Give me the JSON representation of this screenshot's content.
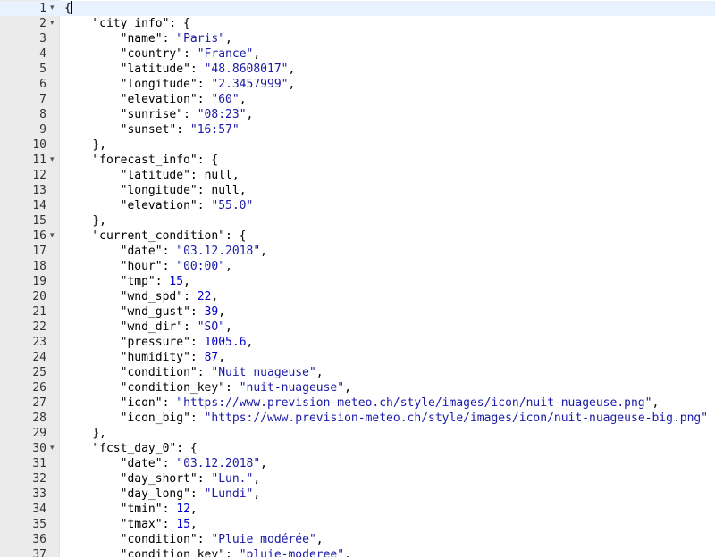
{
  "editor": {
    "lines": [
      {
        "num": "1",
        "fold": true,
        "indent": "",
        "key": "",
        "value": "",
        "vtype": "",
        "suffix": "{"
      },
      {
        "num": "2",
        "fold": true,
        "indent": "    ",
        "key": "\"city_info\"",
        "value": "",
        "vtype": "",
        "suffix": ": {"
      },
      {
        "num": "3",
        "fold": false,
        "indent": "        ",
        "key": "\"name\"",
        "value": "\"Paris\"",
        "vtype": "s",
        "suffix": ","
      },
      {
        "num": "4",
        "fold": false,
        "indent": "        ",
        "key": "\"country\"",
        "value": "\"France\"",
        "vtype": "s",
        "suffix": ","
      },
      {
        "num": "5",
        "fold": false,
        "indent": "        ",
        "key": "\"latitude\"",
        "value": "\"48.8608017\"",
        "vtype": "s",
        "suffix": ","
      },
      {
        "num": "6",
        "fold": false,
        "indent": "        ",
        "key": "\"longitude\"",
        "value": "\"2.3457999\"",
        "vtype": "s",
        "suffix": ","
      },
      {
        "num": "7",
        "fold": false,
        "indent": "        ",
        "key": "\"elevation\"",
        "value": "\"60\"",
        "vtype": "s",
        "suffix": ","
      },
      {
        "num": "8",
        "fold": false,
        "indent": "        ",
        "key": "\"sunrise\"",
        "value": "\"08:23\"",
        "vtype": "s",
        "suffix": ","
      },
      {
        "num": "9",
        "fold": false,
        "indent": "        ",
        "key": "\"sunset\"",
        "value": "\"16:57\"",
        "vtype": "s",
        "suffix": ""
      },
      {
        "num": "10",
        "fold": false,
        "indent": "    ",
        "key": "",
        "value": "",
        "vtype": "",
        "suffix": "},"
      },
      {
        "num": "11",
        "fold": true,
        "indent": "    ",
        "key": "\"forecast_info\"",
        "value": "",
        "vtype": "",
        "suffix": ": {"
      },
      {
        "num": "12",
        "fold": false,
        "indent": "        ",
        "key": "\"latitude\"",
        "value": "null",
        "vtype": "p",
        "suffix": ","
      },
      {
        "num": "13",
        "fold": false,
        "indent": "        ",
        "key": "\"longitude\"",
        "value": "null",
        "vtype": "p",
        "suffix": ","
      },
      {
        "num": "14",
        "fold": false,
        "indent": "        ",
        "key": "\"elevation\"",
        "value": "\"55.0\"",
        "vtype": "s",
        "suffix": ""
      },
      {
        "num": "15",
        "fold": false,
        "indent": "    ",
        "key": "",
        "value": "",
        "vtype": "",
        "suffix": "},"
      },
      {
        "num": "16",
        "fold": true,
        "indent": "    ",
        "key": "\"current_condition\"",
        "value": "",
        "vtype": "",
        "suffix": ": {"
      },
      {
        "num": "17",
        "fold": false,
        "indent": "        ",
        "key": "\"date\"",
        "value": "\"03.12.2018\"",
        "vtype": "s",
        "suffix": ","
      },
      {
        "num": "18",
        "fold": false,
        "indent": "        ",
        "key": "\"hour\"",
        "value": "\"00:00\"",
        "vtype": "s",
        "suffix": ","
      },
      {
        "num": "19",
        "fold": false,
        "indent": "        ",
        "key": "\"tmp\"",
        "value": "15",
        "vtype": "n",
        "suffix": ","
      },
      {
        "num": "20",
        "fold": false,
        "indent": "        ",
        "key": "\"wnd_spd\"",
        "value": "22",
        "vtype": "n",
        "suffix": ","
      },
      {
        "num": "21",
        "fold": false,
        "indent": "        ",
        "key": "\"wnd_gust\"",
        "value": "39",
        "vtype": "n",
        "suffix": ","
      },
      {
        "num": "22",
        "fold": false,
        "indent": "        ",
        "key": "\"wnd_dir\"",
        "value": "\"SO\"",
        "vtype": "s",
        "suffix": ","
      },
      {
        "num": "23",
        "fold": false,
        "indent": "        ",
        "key": "\"pressure\"",
        "value": "1005.6",
        "vtype": "n",
        "suffix": ","
      },
      {
        "num": "24",
        "fold": false,
        "indent": "        ",
        "key": "\"humidity\"",
        "value": "87",
        "vtype": "n",
        "suffix": ","
      },
      {
        "num": "25",
        "fold": false,
        "indent": "        ",
        "key": "\"condition\"",
        "value": "\"Nuit nuageuse\"",
        "vtype": "s",
        "suffix": ","
      },
      {
        "num": "26",
        "fold": false,
        "indent": "        ",
        "key": "\"condition_key\"",
        "value": "\"nuit-nuageuse\"",
        "vtype": "s",
        "suffix": ","
      },
      {
        "num": "27",
        "fold": false,
        "indent": "        ",
        "key": "\"icon\"",
        "value": "\"https://www.prevision-meteo.ch/style/images/icon/nuit-nuageuse.png\"",
        "vtype": "s",
        "suffix": ","
      },
      {
        "num": "28",
        "fold": false,
        "indent": "        ",
        "key": "\"icon_big\"",
        "value": "\"https://www.prevision-meteo.ch/style/images/icon/nuit-nuageuse-big.png\"",
        "vtype": "s",
        "suffix": ""
      },
      {
        "num": "29",
        "fold": false,
        "indent": "    ",
        "key": "",
        "value": "",
        "vtype": "",
        "suffix": "},"
      },
      {
        "num": "30",
        "fold": true,
        "indent": "    ",
        "key": "\"fcst_day_0\"",
        "value": "",
        "vtype": "",
        "suffix": ": {"
      },
      {
        "num": "31",
        "fold": false,
        "indent": "        ",
        "key": "\"date\"",
        "value": "\"03.12.2018\"",
        "vtype": "s",
        "suffix": ","
      },
      {
        "num": "32",
        "fold": false,
        "indent": "        ",
        "key": "\"day_short\"",
        "value": "\"Lun.\"",
        "vtype": "s",
        "suffix": ","
      },
      {
        "num": "33",
        "fold": false,
        "indent": "        ",
        "key": "\"day_long\"",
        "value": "\"Lundi\"",
        "vtype": "s",
        "suffix": ","
      },
      {
        "num": "34",
        "fold": false,
        "indent": "        ",
        "key": "\"tmin\"",
        "value": "12",
        "vtype": "n",
        "suffix": ","
      },
      {
        "num": "35",
        "fold": false,
        "indent": "        ",
        "key": "\"tmax\"",
        "value": "15",
        "vtype": "n",
        "suffix": ","
      },
      {
        "num": "36",
        "fold": false,
        "indent": "        ",
        "key": "\"condition\"",
        "value": "\"Pluie modérée\"",
        "vtype": "s",
        "suffix": ","
      },
      {
        "num": "37",
        "fold": false,
        "indent": "        ",
        "key": "\"condition_key\"",
        "value": "\"pluie-moderee\"",
        "vtype": "s",
        "suffix": ","
      }
    ],
    "fold_icon": "chevron-down-icon",
    "colors": {
      "string": "#1a1aa6",
      "number": "#0000cd",
      "active_line": "#e8f2fe",
      "gutter": "#ebebeb"
    }
  }
}
